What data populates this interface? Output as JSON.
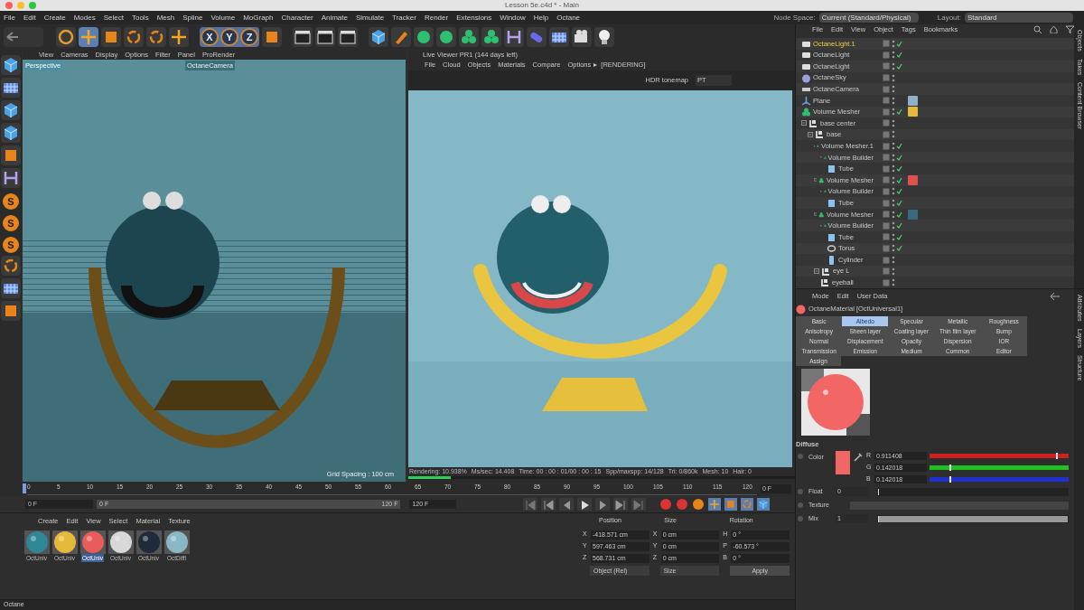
{
  "window": {
    "title": "Lesson 5e.c4d * - Main"
  },
  "menu": [
    "File",
    "Edit",
    "Create",
    "Modes",
    "Select",
    "Tools",
    "Mesh",
    "Spline",
    "Volume",
    "MoGraph",
    "Character",
    "Animate",
    "Simulate",
    "Tracker",
    "Render",
    "Extensions",
    "Window",
    "Help",
    "Octane"
  ],
  "node_space": {
    "label": "Node Space:",
    "value": "Current (Standard/Physical)"
  },
  "layout": {
    "label": "Layout:",
    "value": "Standard"
  },
  "toolbar_axes": [
    "X",
    "Y",
    "Z"
  ],
  "side_tools": [
    "S",
    "S",
    "S"
  ],
  "viewport": {
    "menu": [
      "View",
      "Cameras",
      "Display",
      "Options",
      "Filter",
      "Panel",
      "ProRender"
    ],
    "name": "Perspective",
    "camera": "OctaneCamera",
    "grid": "Grid Spacing : 100 cm"
  },
  "live_viewer": {
    "title": "Live Viewer PR1 (144 days left)",
    "menu": [
      "File",
      "Cloud",
      "Objects",
      "Materials",
      "Compare",
      "Options"
    ],
    "arrow": "▸",
    "state": "[RENDERING]",
    "tonemap": "HDR tonemap",
    "kernel": "PT",
    "progress": {
      "level": 0.11
    },
    "stats": [
      "Rendering: 10.938%",
      "Ms/sec: 14.408",
      "Time: 00 : 00 : 01/00 : 00 : 15",
      "Spp/maxspp: 14/128",
      "Tri: 0/860k",
      "Mesh: 10",
      "Hair: 0"
    ]
  },
  "timeline": {
    "ticks": [
      "0",
      "5",
      "10",
      "15",
      "20",
      "25",
      "30",
      "35",
      "40",
      "45",
      "50",
      "55",
      "60",
      "65",
      "70",
      "75",
      "80",
      "85",
      "90",
      "95",
      "100",
      "105",
      "110",
      "115",
      "120"
    ],
    "frame": "0 F",
    "start": "0 F",
    "slider_start": "0 F",
    "slider_end": "120 F",
    "end": "120 F"
  },
  "materials": {
    "menu": [
      "Create",
      "Edit",
      "View",
      "Select",
      "Material",
      "Texture"
    ],
    "items": [
      {
        "label": "OctUniv",
        "color": "#2e8796",
        "selected": false
      },
      {
        "label": "OctUniv",
        "color": "#e6b93a",
        "selected": false
      },
      {
        "label": "OctUniv",
        "color": "#e85c5c",
        "selected": true
      },
      {
        "label": "OctUniv",
        "color": "#d8d8d8",
        "selected": false
      },
      {
        "label": "OctUniv",
        "color": "#1f2b3a",
        "selected": false
      },
      {
        "label": "OctDiffi",
        "color": "#8ab8c4",
        "selected": false
      }
    ]
  },
  "coordinates": {
    "headers": [
      "Position",
      "Size",
      "Rotation"
    ],
    "rows": [
      {
        "pos_axis": "X",
        "pos": "-418.571 cm",
        "size_axis": "X",
        "size": "0 cm",
        "rot_axis": "H",
        "rot": "0 °"
      },
      {
        "pos_axis": "Y",
        "pos": "597.463 cm",
        "size_axis": "Y",
        "size": "0 cm",
        "rot_axis": "P",
        "rot": "-60.573 °"
      },
      {
        "pos_axis": "Z",
        "pos": "568.731 cm",
        "size_axis": "Z",
        "size": "0 cm",
        "rot_axis": "B",
        "rot": "0 °"
      }
    ],
    "mode": "Object (Rel)",
    "size_mode": "Size",
    "apply": "Apply"
  },
  "status_bar": "Octane",
  "objects": {
    "menu": [
      "File",
      "Edit",
      "View",
      "Object",
      "Tags",
      "Bookmarks"
    ],
    "side_tabs": [
      "Objects",
      "Takes",
      "Content Browser"
    ],
    "tree": [
      {
        "name": "OctaneLight.1",
        "kind": "light",
        "selected": true,
        "checked": true
      },
      {
        "name": "OctaneLight",
        "kind": "light",
        "selected": false,
        "checked": true
      },
      {
        "name": "OctaneLight",
        "kind": "light",
        "selected": false,
        "checked": true
      },
      {
        "name": "OctaneSky",
        "kind": "sky",
        "selected": false,
        "checked": false
      },
      {
        "name": "OctaneCamera",
        "kind": "camera",
        "selected": false,
        "checked": false
      },
      {
        "name": "Plane",
        "kind": "plane",
        "selected": false,
        "checked": false,
        "color": "#8fb0c8"
      },
      {
        "name": "Volume Mesher",
        "kind": "mesher",
        "selected": false,
        "checked": true,
        "color": "#e6b93a"
      },
      {
        "name": "base center",
        "kind": "null",
        "selected": false,
        "checked": false,
        "children": [
          {
            "name": "base",
            "kind": "null",
            "selected": false,
            "checked": false,
            "children": [
              {
                "name": "Volume Mesher.1",
                "kind": "mesher",
                "selected": false,
                "checked": true,
                "children": [
                  {
                    "name": "Volume Builder",
                    "kind": "builder",
                    "selected": false,
                    "checked": true,
                    "children": [
                      {
                        "name": "Tube",
                        "kind": "tube",
                        "selected": false,
                        "checked": true
                      }
                    ]
                  }
                ]
              },
              {
                "name": "Volume Mesher",
                "kind": "mesher",
                "selected": false,
                "checked": true,
                "color": "#e05050",
                "children": [
                  {
                    "name": "Volume Builder",
                    "kind": "builder",
                    "selected": false,
                    "checked": true,
                    "children": [
                      {
                        "name": "Tube",
                        "kind": "tube",
                        "selected": false,
                        "checked": true
                      }
                    ]
                  }
                ]
              },
              {
                "name": "Volume Mesher",
                "kind": "mesher",
                "selected": false,
                "checked": true,
                "color": "#3a6a80",
                "children": [
                  {
                    "name": "Volume Builder",
                    "kind": "builder",
                    "selected": false,
                    "checked": true,
                    "children": [
                      {
                        "name": "Tube",
                        "kind": "tube",
                        "selected": false,
                        "checked": true
                      },
                      {
                        "name": "Torus",
                        "kind": "torus",
                        "selected": false,
                        "checked": true
                      },
                      {
                        "name": "Cylinder",
                        "kind": "cylinder",
                        "selected": false,
                        "checked": false
                      }
                    ]
                  }
                ]
              },
              {
                "name": "eye L",
                "kind": "null",
                "selected": false,
                "checked": false,
                "children": [
                  {
                    "name": "eyeball",
                    "kind": "null",
                    "selected": false,
                    "checked": false
                  }
                ]
              }
            ]
          }
        ]
      }
    ]
  },
  "attributes": {
    "menu": [
      "Mode",
      "Edit",
      "User Data"
    ],
    "title": "OctaneMaterial [OctUniversal1]",
    "side_tabs": [
      "Attributes",
      "Layers",
      "Structure"
    ],
    "tabs": [
      {
        "label": "Basic",
        "selected": false
      },
      {
        "label": "Albedo",
        "selected": true
      },
      {
        "label": "Specular",
        "selected": false
      },
      {
        "label": "Metallic",
        "selected": false
      },
      {
        "label": "Roughness",
        "selected": false
      },
      {
        "label": "Anisotropy",
        "selected": false
      },
      {
        "label": "Sheen layer",
        "selected": false
      },
      {
        "label": "Coating layer",
        "selected": false
      },
      {
        "label": "Thin film layer",
        "selected": false
      },
      {
        "label": "Bump",
        "selected": false
      },
      {
        "label": "Normal",
        "selected": false
      },
      {
        "label": "Displacement",
        "selected": false
      },
      {
        "label": "Opacity",
        "selected": false
      },
      {
        "label": "Dispersion",
        "selected": false
      },
      {
        "label": "IOR",
        "selected": false
      },
      {
        "label": "Transmission",
        "selected": false
      },
      {
        "label": "Emission",
        "selected": false
      },
      {
        "label": "Medium",
        "selected": false
      },
      {
        "label": "Common",
        "selected": false
      },
      {
        "label": "Editor",
        "selected": false
      }
    ],
    "assign": "Assign",
    "section": "Diffuse",
    "color_label": "Color",
    "swatch": {
      "color": "#f26666"
    },
    "channels": [
      {
        "axis": "R",
        "value": "0.911408",
        "level": 0.911,
        "color": "#d02020"
      },
      {
        "axis": "G",
        "value": "0.142018",
        "level": 0.142,
        "color": "#20c020"
      },
      {
        "axis": "B",
        "value": "0.142018",
        "level": 0.142,
        "color": "#2030d0"
      }
    ],
    "float": {
      "label": "Float",
      "value": "0",
      "level": 0
    },
    "texture": {
      "label": "Texture"
    },
    "mix": {
      "label": "Mix",
      "value": "1",
      "level": 1
    }
  }
}
